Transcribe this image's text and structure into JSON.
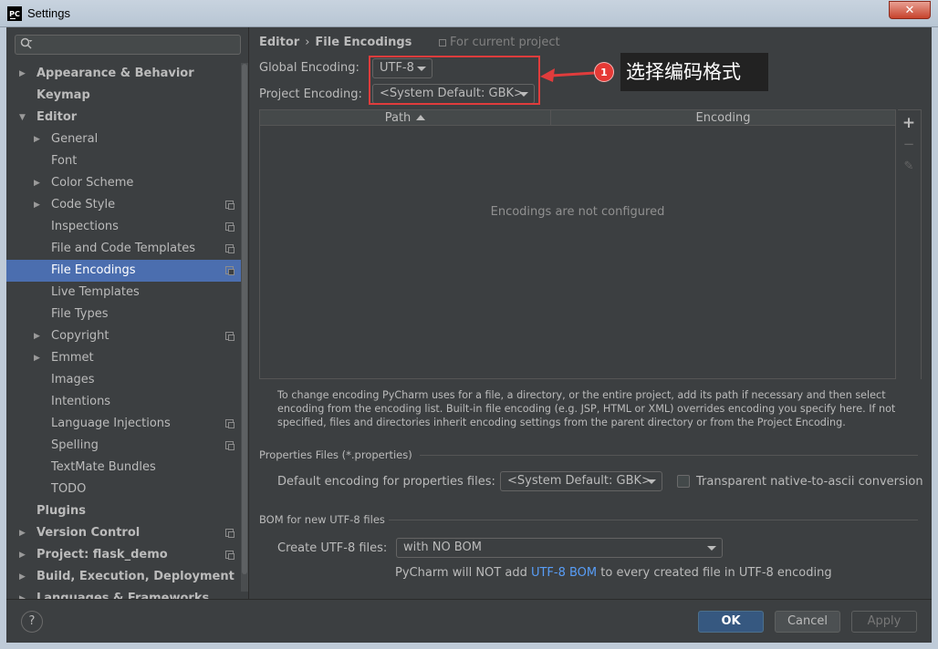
{
  "window": {
    "title": "Settings",
    "app_icon": "PC",
    "close_glyph": "✕"
  },
  "search": {
    "placeholder": "",
    "icon": "search-icon"
  },
  "tree": [
    {
      "label": "Appearance & Behavior",
      "level": 0,
      "bold": true,
      "arrow": "▶",
      "copy": false
    },
    {
      "label": "Keymap",
      "level": 0,
      "bold": true,
      "arrow": "",
      "copy": false
    },
    {
      "label": "Editor",
      "level": 0,
      "bold": true,
      "arrow": "▼",
      "copy": false
    },
    {
      "label": "General",
      "level": 1,
      "bold": false,
      "arrow": "▶",
      "copy": false
    },
    {
      "label": "Font",
      "level": 1,
      "bold": false,
      "arrow": "",
      "copy": false
    },
    {
      "label": "Color Scheme",
      "level": 1,
      "bold": false,
      "arrow": "▶",
      "copy": false
    },
    {
      "label": "Code Style",
      "level": 1,
      "bold": false,
      "arrow": "▶",
      "copy": true
    },
    {
      "label": "Inspections",
      "level": 1,
      "bold": false,
      "arrow": "",
      "copy": true
    },
    {
      "label": "File and Code Templates",
      "level": 1,
      "bold": false,
      "arrow": "",
      "copy": true
    },
    {
      "label": "File Encodings",
      "level": 1,
      "bold": false,
      "arrow": "",
      "copy": true,
      "selected": true
    },
    {
      "label": "Live Templates",
      "level": 1,
      "bold": false,
      "arrow": "",
      "copy": false
    },
    {
      "label": "File Types",
      "level": 1,
      "bold": false,
      "arrow": "",
      "copy": false
    },
    {
      "label": "Copyright",
      "level": 1,
      "bold": false,
      "arrow": "▶",
      "copy": true
    },
    {
      "label": "Emmet",
      "level": 1,
      "bold": false,
      "arrow": "▶",
      "copy": false
    },
    {
      "label": "Images",
      "level": 1,
      "bold": false,
      "arrow": "",
      "copy": false
    },
    {
      "label": "Intentions",
      "level": 1,
      "bold": false,
      "arrow": "",
      "copy": false
    },
    {
      "label": "Language Injections",
      "level": 1,
      "bold": false,
      "arrow": "",
      "copy": true
    },
    {
      "label": "Spelling",
      "level": 1,
      "bold": false,
      "arrow": "",
      "copy": true
    },
    {
      "label": "TextMate Bundles",
      "level": 1,
      "bold": false,
      "arrow": "",
      "copy": false
    },
    {
      "label": "TODO",
      "level": 1,
      "bold": false,
      "arrow": "",
      "copy": false
    },
    {
      "label": "Plugins",
      "level": 0,
      "bold": true,
      "arrow": "",
      "copy": false
    },
    {
      "label": "Version Control",
      "level": 0,
      "bold": true,
      "arrow": "▶",
      "copy": true
    },
    {
      "label": "Project: flask_demo",
      "level": 0,
      "bold": true,
      "arrow": "▶",
      "copy": true
    },
    {
      "label": "Build, Execution, Deployment",
      "level": 0,
      "bold": true,
      "arrow": "▶",
      "copy": false
    },
    {
      "label": "Languages & Frameworks",
      "level": 0,
      "bold": true,
      "arrow": "▶",
      "copy": false
    }
  ],
  "breadcrumb": {
    "parent": "Editor",
    "separator": "›",
    "current": "File Encodings"
  },
  "scope_label": "For current project",
  "global_encoding": {
    "label": "Global Encoding:",
    "value": "UTF-8"
  },
  "project_encoding": {
    "label": "Project Encoding:",
    "value": "<System Default: GBK>"
  },
  "annotation": {
    "badge": "1",
    "callout": "选择编码格式",
    "color": "#e03c3c"
  },
  "table": {
    "col_path": "Path",
    "col_encoding": "Encoding",
    "empty_text": "Encodings are not configured",
    "add_glyph": "+",
    "remove_glyph": "−",
    "edit_glyph": "✎"
  },
  "help_text": "To change encoding PyCharm uses for a file, a directory, or the entire project, add its path if necessary and then select encoding from the encoding list. Built-in file encoding (e.g. JSP, HTML or XML) overrides encoding you specify here. If not specified, files and directories inherit encoding settings from the parent directory or from the Project Encoding.",
  "properties": {
    "section_title": "Properties Files (*.properties)",
    "default_label": "Default encoding for properties files:",
    "default_value": "<System Default: GBK>",
    "transparent_label": "Transparent native-to-ascii conversion",
    "transparent_checked": false
  },
  "bom": {
    "section_title": "BOM for new UTF-8 files",
    "create_label": "Create UTF-8 files:",
    "create_value": "with NO BOM",
    "note_prefix": "PyCharm will NOT add ",
    "note_link": "UTF-8 BOM",
    "note_suffix": " to every created file in UTF-8 encoding"
  },
  "buttons": {
    "help": "?",
    "ok": "OK",
    "cancel": "Cancel",
    "apply": "Apply"
  },
  "colors": {
    "selection": "#4b6eaf",
    "primary_button": "#365880",
    "link": "#589df6"
  }
}
